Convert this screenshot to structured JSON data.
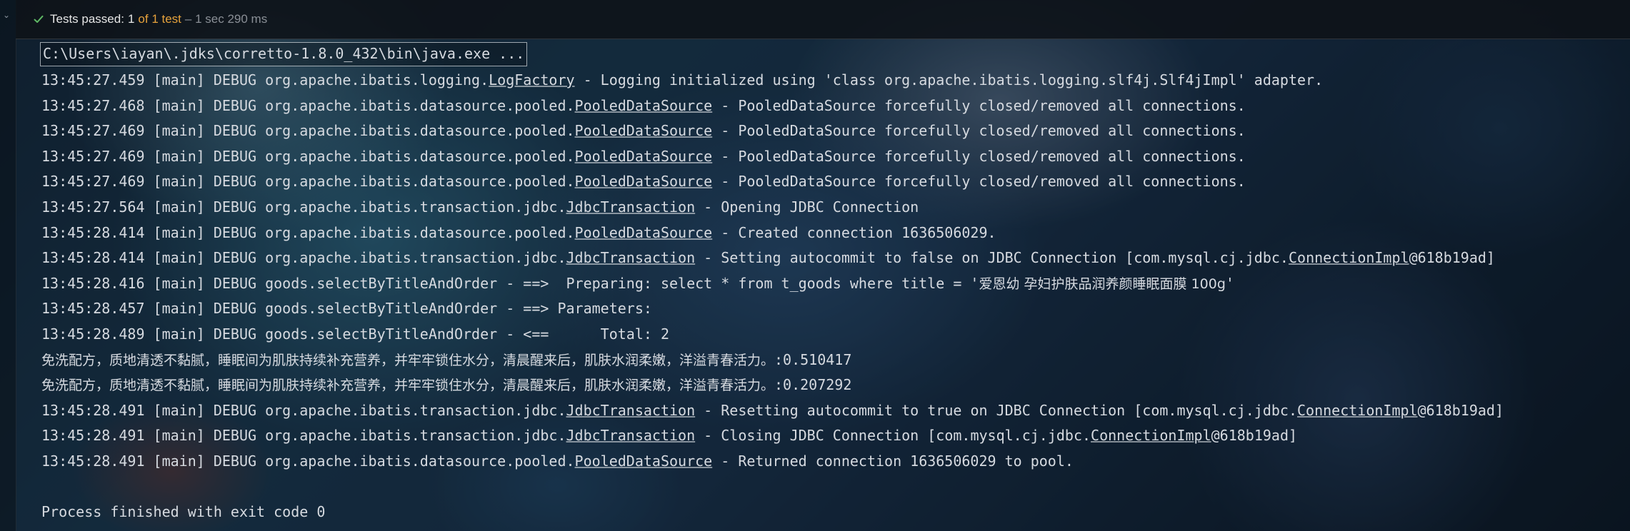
{
  "status_bar": {
    "icon": "check-icon",
    "label": "Tests passed:",
    "count": "1",
    "of_total": "of 1 test",
    "duration": "– 1 sec 290 ms",
    "colors": {
      "passed": "#5fb865",
      "accent": "#e6a23c",
      "muted": "#8a8f96"
    }
  },
  "console": {
    "command": "C:\\Users\\iayan\\.jdks\\corretto-1.8.0_432\\bin\\java.exe ...",
    "lines": [
      {
        "pre": "13:45:27.459 [main] DEBUG org.apache.ibatis.logging.",
        "cls": "LogFactory",
        "post": " - Logging initialized using 'class org.apache.ibatis.logging.slf4j.Slf4jImpl' adapter."
      },
      {
        "pre": "13:45:27.468 [main] DEBUG org.apache.ibatis.datasource.pooled.",
        "cls": "PooledDataSource",
        "post": " - PooledDataSource forcefully closed/removed all connections."
      },
      {
        "pre": "13:45:27.469 [main] DEBUG org.apache.ibatis.datasource.pooled.",
        "cls": "PooledDataSource",
        "post": " - PooledDataSource forcefully closed/removed all connections."
      },
      {
        "pre": "13:45:27.469 [main] DEBUG org.apache.ibatis.datasource.pooled.",
        "cls": "PooledDataSource",
        "post": " - PooledDataSource forcefully closed/removed all connections."
      },
      {
        "pre": "13:45:27.469 [main] DEBUG org.apache.ibatis.datasource.pooled.",
        "cls": "PooledDataSource",
        "post": " - PooledDataSource forcefully closed/removed all connections."
      },
      {
        "pre": "13:45:27.564 [main] DEBUG org.apache.ibatis.transaction.jdbc.",
        "cls": "JdbcTransaction",
        "post": " - Opening JDBC Connection"
      },
      {
        "pre": "13:45:28.414 [main] DEBUG org.apache.ibatis.datasource.pooled.",
        "cls": "PooledDataSource",
        "post": " - Created connection 1636506029."
      },
      {
        "pre": "13:45:28.414 [main] DEBUG org.apache.ibatis.transaction.jdbc.",
        "cls": "JdbcTransaction",
        "post": " - Setting autocommit to false on JDBC Connection [com.mysql.cj.jdbc.",
        "cls2": "ConnectionImpl",
        "post2": "@618b19ad]"
      },
      {
        "pre": "13:45:28.416 [main] DEBUG goods.selectByTitleAndOrder - ==>  Preparing: select * from t_goods where title = '",
        "cjk": "爱恩幼 孕妇护肤品润养颜睡眠面膜 100g",
        "post": "'"
      },
      {
        "pre": "13:45:28.457 [main] DEBUG goods.selectByTitleAndOrder - ==> Parameters: "
      },
      {
        "pre": "13:45:28.489 [main] DEBUG goods.selectByTitleAndOrder - <==      Total: 2"
      },
      {
        "cjk": "免洗配方，质地清透不黏腻，睡眠间为肌肤持续补充营养，并牢牢锁住水分，清晨醒来后，肌肤水润柔嫩，洋溢青春活力。",
        "post": ":0.510417"
      },
      {
        "cjk": "免洗配方，质地清透不黏腻，睡眠间为肌肤持续补充营养，并牢牢锁住水分，清晨醒来后，肌肤水润柔嫩，洋溢青春活力。",
        "post": ":0.207292"
      },
      {
        "pre": "13:45:28.491 [main] DEBUG org.apache.ibatis.transaction.jdbc.",
        "cls": "JdbcTransaction",
        "post": " - Resetting autocommit to true on JDBC Connection [com.mysql.cj.jdbc.",
        "cls2": "ConnectionImpl",
        "post2": "@618b19ad]"
      },
      {
        "pre": "13:45:28.491 [main] DEBUG org.apache.ibatis.transaction.jdbc.",
        "cls": "JdbcTransaction",
        "post": " - Closing JDBC Connection [com.mysql.cj.jdbc.",
        "cls2": "ConnectionImpl",
        "post2": "@618b19ad]"
      },
      {
        "pre": "13:45:28.491 [main] DEBUG org.apache.ibatis.datasource.pooled.",
        "cls": "PooledDataSource",
        "post": " - Returned connection 1636506029 to pool."
      },
      {
        "pre": ""
      },
      {
        "pre": "Process finished with exit code 0"
      }
    ]
  }
}
